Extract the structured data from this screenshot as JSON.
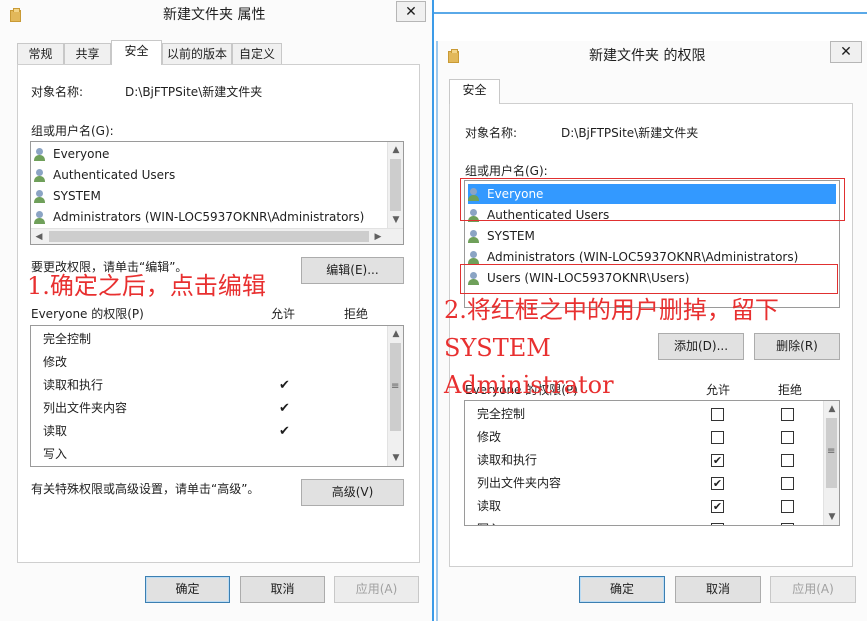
{
  "colors": {
    "accent_blue": "#3399ff",
    "annotation_red": "#e83030"
  },
  "left_window": {
    "title": "新建文件夹 属性",
    "close_symbol": "✕",
    "tabs": [
      "常规",
      "共享",
      "安全",
      "以前的版本",
      "自定义"
    ],
    "active_tab": "安全",
    "object_name_label": "对象名称:",
    "object_name_value": "D:\\BjFTPSite\\新建文件夹",
    "group_label": "组或用户名(G):",
    "users": [
      "Everyone",
      "Authenticated Users",
      "SYSTEM",
      "Administrators (WIN-LOC5937OKNR\\Administrators)"
    ],
    "edit_hint": "要更改权限，请单击“编辑”。",
    "edit_button": "编辑(E)...",
    "perm_title": "Everyone 的权限(P)",
    "allow_header": "允许",
    "deny_header": "拒绝",
    "permissions": [
      {
        "name": "完全控制",
        "allow": false
      },
      {
        "name": "修改",
        "allow": false
      },
      {
        "name": "读取和执行",
        "allow": true
      },
      {
        "name": "列出文件夹内容",
        "allow": true
      },
      {
        "name": "读取",
        "allow": true
      },
      {
        "name": "写入",
        "allow": false
      }
    ],
    "check_symbol": "✔",
    "advanced_hint": "有关特殊权限或高级设置，请单击“高级”。",
    "advanced_button": "高级(V)",
    "ok_button": "确定",
    "cancel_button": "取消",
    "apply_button": "应用(A)"
  },
  "right_window": {
    "title": "新建文件夹 的权限",
    "close_symbol": "✕",
    "tab": "安全",
    "object_name_label": "对象名称:",
    "object_name_value": "D:\\BjFTPSite\\新建文件夹",
    "group_label": "组或用户名(G):",
    "users": [
      "Everyone",
      "Authenticated Users",
      "SYSTEM",
      "Administrators (WIN-LOC5937OKNR\\Administrators)",
      "Users (WIN-LOC5937OKNR\\Users)"
    ],
    "selected_user": "Everyone",
    "add_button": "添加(D)...",
    "remove_button": "删除(R)",
    "perm_title": "Everyone 的权限(P)",
    "allow_header": "允许",
    "deny_header": "拒绝",
    "permissions": [
      {
        "name": "完全控制",
        "allow": false,
        "deny": false
      },
      {
        "name": "修改",
        "allow": false,
        "deny": false
      },
      {
        "name": "读取和执行",
        "allow": true,
        "deny": false
      },
      {
        "name": "列出文件夹内容",
        "allow": true,
        "deny": false
      },
      {
        "name": "读取",
        "allow": true,
        "deny": false
      },
      {
        "name": "写入",
        "allow": false,
        "deny": false
      }
    ],
    "check_symbol": "✔",
    "ok_button": "确定",
    "cancel_button": "取消",
    "apply_button": "应用(A)"
  },
  "annotations": {
    "note1": "1.确定之后，点击编辑",
    "note2_line1": "2.将红框之中的用户删掉，留下",
    "note2_line2": "SYSTEM",
    "note2_line3": "Administrator"
  }
}
